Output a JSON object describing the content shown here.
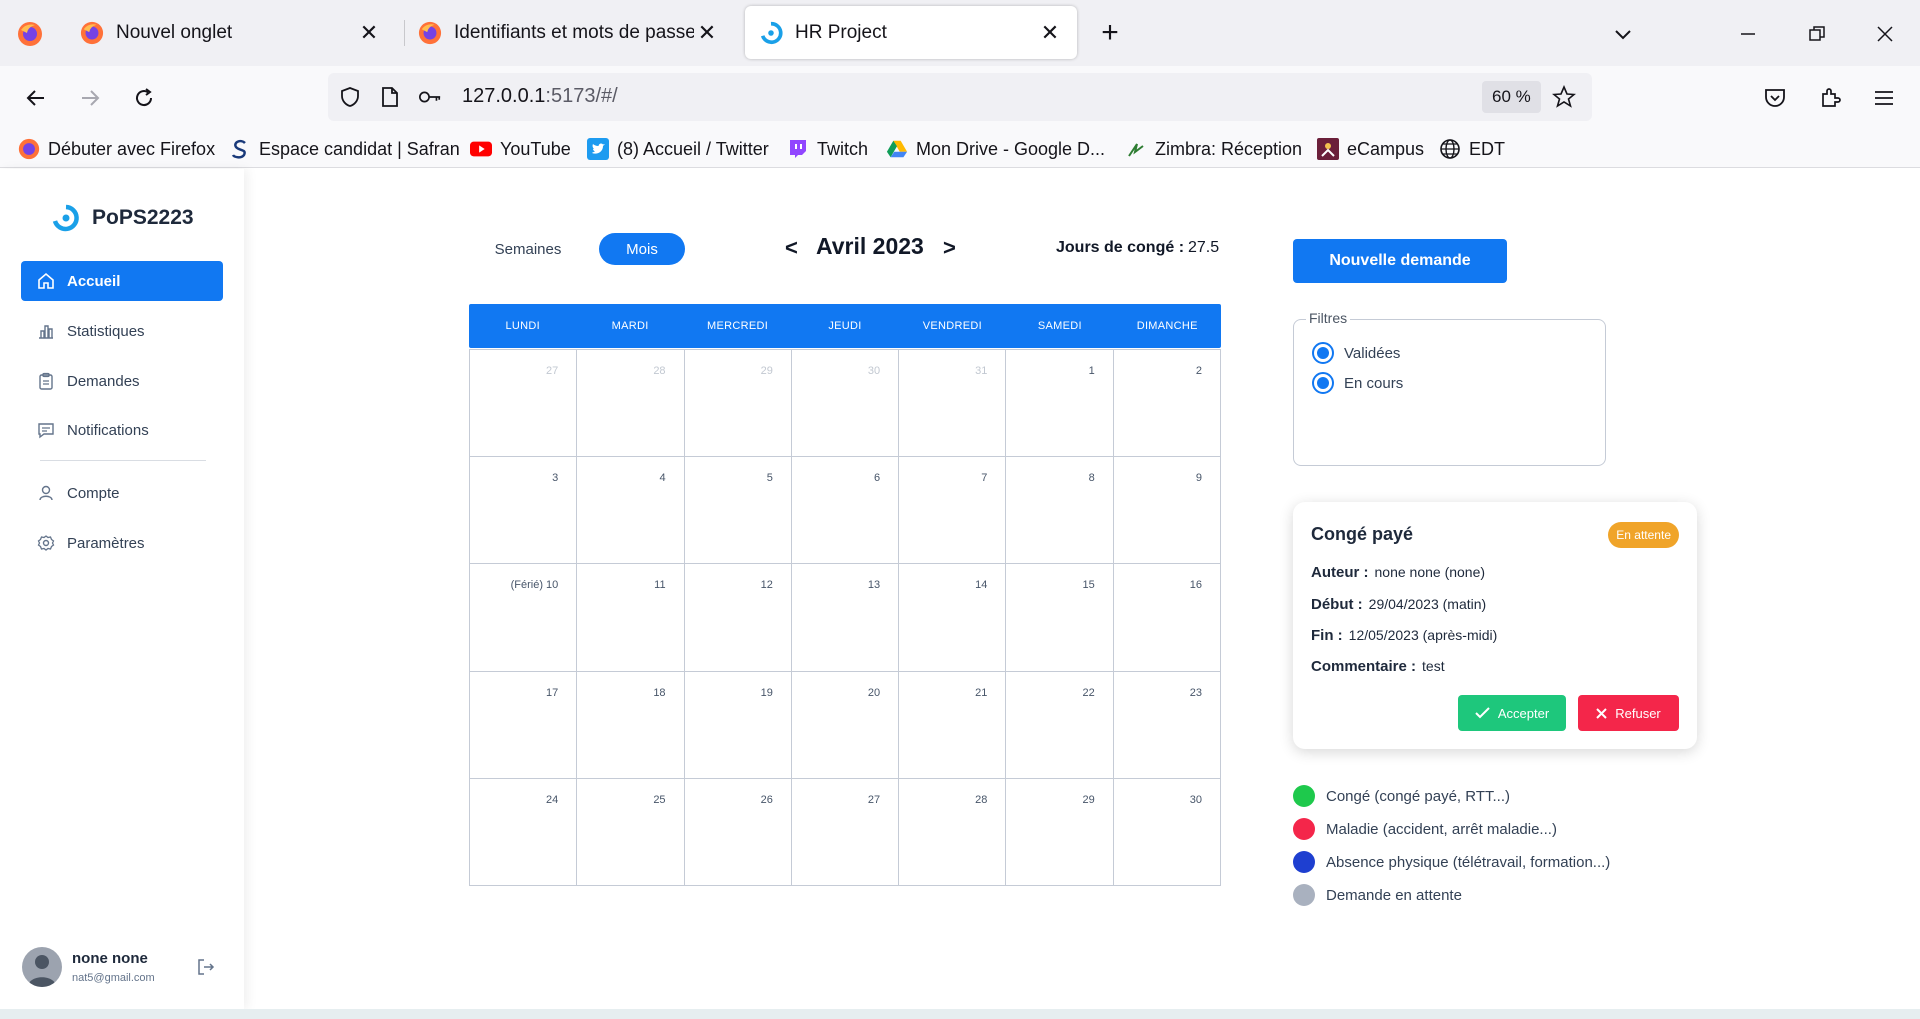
{
  "browser": {
    "tabs": [
      {
        "title": "Nouvel onglet"
      },
      {
        "title": "Identifiants et mots de passe"
      },
      {
        "title": "HR Project"
      }
    ],
    "url_host": "127.0.0.1",
    "url_rest": ":5173/#/",
    "zoom": "60 %",
    "bookmarks": [
      {
        "label": "Débuter avec Firefox",
        "icon": "firefox-icon"
      },
      {
        "label": "Espace candidat | Safran",
        "icon": "safran-icon"
      },
      {
        "label": "YouTube",
        "icon": "youtube-icon"
      },
      {
        "label": "(8) Accueil / Twitter",
        "icon": "twitter-icon"
      },
      {
        "label": "Twitch",
        "icon": "twitch-icon"
      },
      {
        "label": "Mon Drive - Google D...",
        "icon": "google-drive-icon"
      },
      {
        "label": "Zimbra: Réception",
        "icon": "zimbra-icon"
      },
      {
        "label": "eCampus",
        "icon": "ecampus-icon"
      },
      {
        "label": "EDT",
        "icon": "globe-icon"
      }
    ]
  },
  "sidebar": {
    "brand": "PoPS2223",
    "items": [
      {
        "label": "Accueil",
        "icon": "home-icon",
        "active": true
      },
      {
        "label": "Statistiques",
        "icon": "chart-icon"
      },
      {
        "label": "Demandes",
        "icon": "clipboard-icon"
      },
      {
        "label": "Notifications",
        "icon": "message-icon"
      },
      {
        "label": "Compte",
        "icon": "user-icon"
      },
      {
        "label": "Paramètres",
        "icon": "gear-icon"
      }
    ],
    "user": {
      "name": "none none",
      "email": "nat5@gmail.com"
    }
  },
  "calendar": {
    "view_weeks": "Semaines",
    "view_month": "Mois",
    "prev": "<",
    "next": ">",
    "title": "Avril 2023",
    "leave_label": "Jours de congé :",
    "leave_value": "27.5",
    "weekdays": [
      "LUNDI",
      "MARDI",
      "MERCREDI",
      "JEUDI",
      "VENDREDI",
      "SAMEDI",
      "DIMANCHE"
    ],
    "days": [
      "27",
      "28",
      "29",
      "30",
      "31",
      "1",
      "2",
      "3",
      "4",
      "5",
      "6",
      "7",
      "8",
      "9",
      "(Férié) 10",
      "11",
      "12",
      "13",
      "14",
      "15",
      "16",
      "17",
      "18",
      "19",
      "20",
      "21",
      "22",
      "23",
      "24",
      "25",
      "26",
      "27",
      "28",
      "29",
      "30"
    ],
    "other_month_count": 5
  },
  "panel": {
    "new_request": "Nouvelle demande",
    "filters_label": "Filtres",
    "filters": [
      "Validées",
      "En cours"
    ],
    "card": {
      "title": "Congé payé",
      "badge": "En attente",
      "author_label": "Auteur :",
      "author_value": "none none (none)",
      "start_label": "Début :",
      "start_value": "29/04/2023 (matin)",
      "end_label": "Fin :",
      "end_value": "12/05/2023 (après-midi)",
      "comment_label": "Commentaire :",
      "comment_value": "test",
      "accept": "Accepter",
      "refuse": "Refuser"
    },
    "legend": [
      {
        "label": "Congé (congé payé, RTT...)",
        "color": "#1ec94c"
      },
      {
        "label": "Maladie (accident, arrêt maladie...)",
        "color": "#f4264a"
      },
      {
        "label": "Absence physique (télétravail, formation...)",
        "color": "#1e3fd0"
      },
      {
        "label": "Demande en attente",
        "color": "#a9b1bf"
      }
    ]
  },
  "colors": {
    "accent": "#1178f2",
    "pending": "#f0a429",
    "accept": "#1ec77c",
    "refuse": "#f4264a"
  }
}
